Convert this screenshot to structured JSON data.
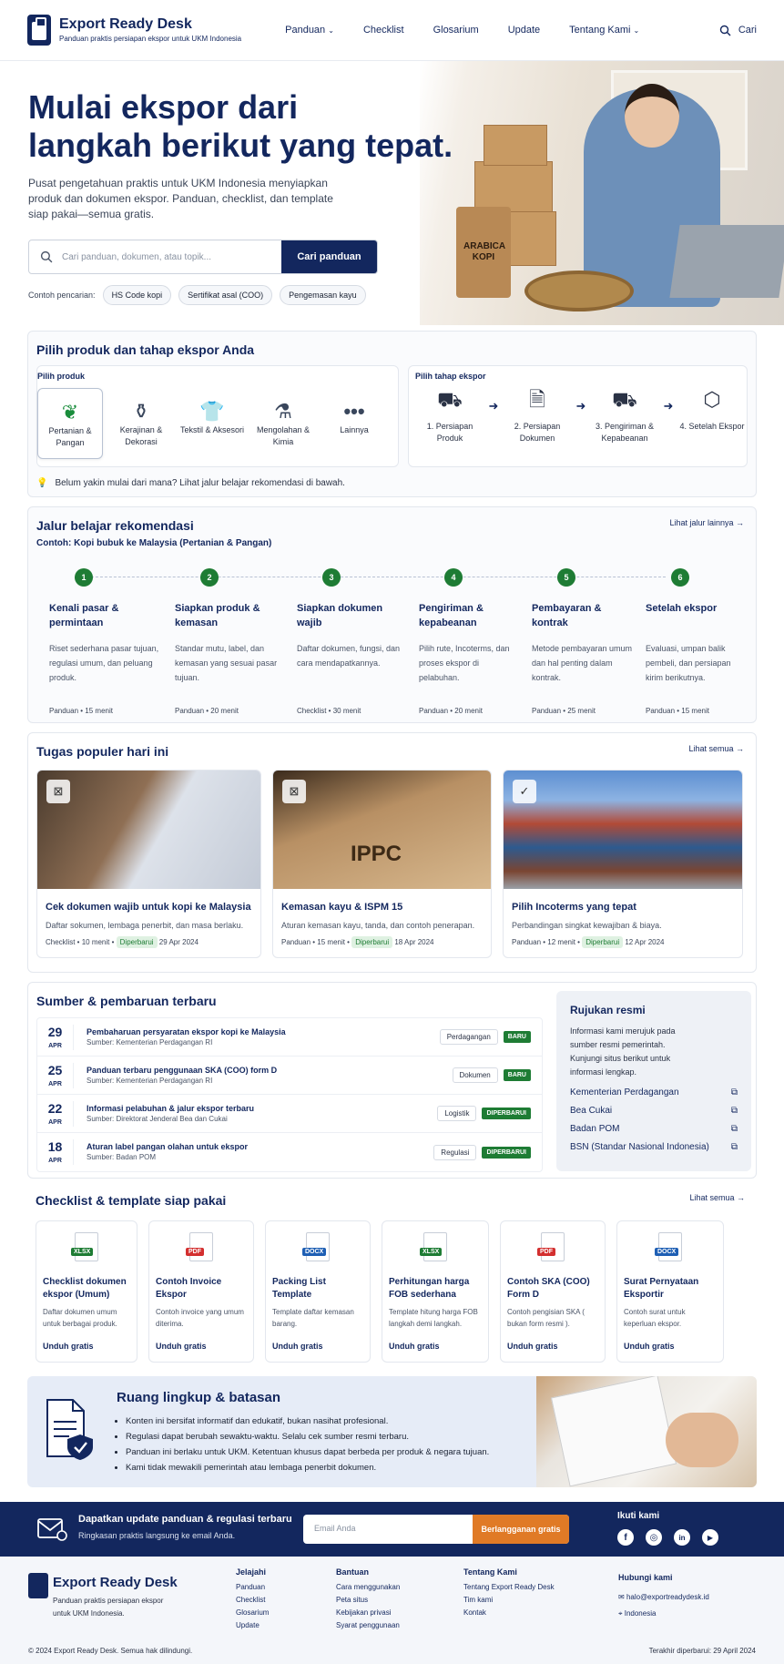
{
  "header": {
    "brand": "Export Ready Desk",
    "tagline": "Panduan praktis persiapan ekspor untuk UKM Indonesia",
    "nav": [
      "Panduan",
      "Checklist",
      "Glosarium",
      "Update",
      "Tentang Kami"
    ],
    "search_label": "Cari"
  },
  "hero": {
    "title_line1": "Mulai ekspor dari",
    "title_line2": "langkah berikut yang tepat.",
    "desc": "Pusat pengetahuan praktis untuk UKM Indonesia menyiapkan produk dan dokumen ekspor. Panduan, checklist, dan template siap pakai—semua gratis.",
    "search_placeholder": "Cari panduan, dokumen, atau topik...",
    "search_button": "Cari panduan",
    "examples_label": "Contoh pencarian:",
    "examples": [
      "HS Code kopi",
      "Sertifikat asal (COO)",
      "Pengemasan kayu"
    ],
    "bag_text": "ARABICA KOPI"
  },
  "picker": {
    "title": "Pilih produk dan tahap ekspor Anda",
    "product_label": "Pilih produk",
    "products": [
      "Pertanian & Pangan",
      "Kerajinan & Dekorasi",
      "Tekstil & Aksesori",
      "Mengolahan & Kimia",
      "Lainnya"
    ],
    "stage_label": "Pilih tahap ekspor",
    "stages": [
      "1. Persiapan Produk",
      "2. Persiapan Dokumen",
      "3. Pengiriman & Kepabeanan",
      "4. Setelah Ekspor"
    ],
    "hint": "Belum yakin mulai dari mana? Lihat jalur belajar rekomendasi di bawah."
  },
  "path": {
    "title": "Jalur belajar rekomendasi",
    "subtitle": "Contoh: Kopi bubuk ke Malaysia (Pertanian & Pangan)",
    "more": "Lihat jalur lainnya →",
    "steps": [
      {
        "n": "1",
        "title": "Kenali pasar & permintaan",
        "desc": "Riset sederhana pasar tujuan, regulasi umum, dan peluang produk.",
        "meta": "Panduan  •  15 menit"
      },
      {
        "n": "2",
        "title": "Siapkan produk & kemasan",
        "desc": "Standar mutu, label, dan kemasan yang sesuai pasar tujuan.",
        "meta": "Panduan  •  20 menit"
      },
      {
        "n": "3",
        "title": "Siapkan dokumen wajib",
        "desc": "Daftar dokumen, fungsi, dan cara mendapatkannya.",
        "meta": "Checklist  •  30 menit"
      },
      {
        "n": "4",
        "title": "Pengiriman & kepabeanan",
        "desc": "Pilih rute, Incoterms, dan proses ekspor di pelabuhan.",
        "meta": "Panduan  •  20 menit"
      },
      {
        "n": "5",
        "title": "Pembayaran & kontrak",
        "desc": "Metode pembayaran umum dan hal penting dalam kontrak.",
        "meta": "Panduan  •  25 menit"
      },
      {
        "n": "6",
        "title": "Setelah ekspor",
        "desc": "Evaluasi, umpan balik pembeli, dan persiapan kirim berikutnya.",
        "meta": "Panduan  •  15 menit"
      }
    ]
  },
  "tasks": {
    "title": "Tugas populer hari ini",
    "more": "Lihat semua →",
    "items": [
      {
        "title": "Cek dokumen wajib untuk kopi ke Malaysia",
        "desc": "Daftar sokumen, lembaga penerbit, dan masa berlaku.",
        "type": "Checklist  •  10 menit  •",
        "badge": "Diperbarui",
        "date": "29 Apr 2024"
      },
      {
        "title": "Kemasan kayu & ISPM 15",
        "desc": "Aturan kemasan kayu, tanda, dan contoh penerapan.",
        "type": "Panduan  •  15 menit  •",
        "badge": "Diperbarui",
        "date": "18 Apr 2024",
        "stamp": "IPPC"
      },
      {
        "title": "Pilih Incoterms yang tepat",
        "desc": "Perbandingan singkat kewajiban & biaya.",
        "type": "Panduan  •  12 menit  •",
        "badge": "Diperbarui",
        "date": "12 Apr 2024"
      }
    ]
  },
  "sources": {
    "title": "Sumber & pembaruan terbaru",
    "items": [
      {
        "day": "29",
        "mon": "APR",
        "title": "Pembaharuan persyaratan ekspor kopi ke Malaysia",
        "src": "Sumber: Kementerian Perdagangan RI",
        "cat": "Perdagangan",
        "badge": "BARU"
      },
      {
        "day": "25",
        "mon": "APR",
        "title": "Panduan terbaru penggunaan SKA (COO) form D",
        "src": "Sumber: Kementerian Perdagangan RI",
        "cat": "Dokumen",
        "badge": "BARU"
      },
      {
        "day": "22",
        "mon": "APR",
        "title": "Informasi pelabuhan & jalur ekspor terbaru",
        "src": "Sumber: Direktorat Jenderal Bea dan Cukai",
        "cat": "Logistik",
        "badge": "DIPERBARUI"
      },
      {
        "day": "18",
        "mon": "APR",
        "title": "Aturan label pangan olahan untuk ekspor",
        "src": "Sumber: Badan POM",
        "cat": "Regulasi",
        "badge": "DIPERBARUI"
      }
    ],
    "ref_title": "Rujukan resmi",
    "ref_desc": "Informasi kami merujuk pada sumber resmi pemerintah. Kunjungi situs berikut untuk informasi lengkap.",
    "refs": [
      "Kementerian Perdagangan",
      "Bea Cukai",
      "Badan POM",
      "BSN (Standar Nasional Indonesia)"
    ]
  },
  "templates": {
    "title": "Checklist & template siap pakai",
    "more": "Lihat semua →",
    "download": "Unduh gratis",
    "items": [
      {
        "fmt": "XLSX",
        "color": "#1e7c34",
        "title": "Checklist dokumen ekspor (Umum)",
        "desc": "Daftar dokumen umum untuk berbagai produk."
      },
      {
        "fmt": "PDF",
        "color": "#d32f2f",
        "title": "Contoh Invoice Ekspor",
        "desc": "Contoh invoice yang umum diterima."
      },
      {
        "fmt": "DOCX",
        "color": "#1e5fb4",
        "title": "Packing List Template",
        "desc": "Template daftar kemasan barang."
      },
      {
        "fmt": "XLSX",
        "color": "#1e7c34",
        "title": "Perhitungan harga FOB sederhana",
        "desc": "Template hitung harga FOB langkah demi langkah."
      },
      {
        "fmt": "PDF",
        "color": "#d32f2f",
        "title": "Contoh SKA (COO) Form D",
        "desc": "Contoh pengisian SKA ( bukan form resmi )."
      },
      {
        "fmt": "DOCX",
        "color": "#1e5fb4",
        "title": "Surat Pernyataan Eksportir",
        "desc": "Contoh surat untuk keperluan ekspor."
      }
    ]
  },
  "scope": {
    "title": "Ruang lingkup & batasan",
    "points": [
      "Konten ini bersifat informatif dan edukatif, bukan nasihat profesional.",
      "Regulasi dapat berubah sewaktu-waktu. Selalu cek sumber resmi terbaru.",
      "Panduan ini berlaku untuk UKM. Ketentuan khusus dapat berbeda per produk & negara tujuan.",
      "Kami tidak mewakili pemerintah atau lembaga penerbit dokumen."
    ]
  },
  "newsletter": {
    "title": "Dapatkan update panduan & regulasi terbaru",
    "sub": "Ringkasan praktis langsung ke email Anda.",
    "placeholder": "Email Anda",
    "button": "Berlangganan gratis",
    "follow": "Ikuti kami"
  },
  "footer": {
    "brand": "Export Ready Desk",
    "tagline": "Panduan praktis persiapan ekspor untuk UKM Indonesia.",
    "cols": [
      {
        "title": "Jelajahi",
        "links": [
          "Panduan",
          "Checklist",
          "Glosarium",
          "Update"
        ]
      },
      {
        "title": "Bantuan",
        "links": [
          "Cara menggunakan",
          "Peta situs",
          "Kebijakan privasi",
          "Syarat penggunaan"
        ]
      },
      {
        "title": "Tentang Kami",
        "links": [
          "Tentang Export Ready Desk",
          "Tim kami",
          "Kontak"
        ]
      }
    ],
    "contact_title": "Hubungi kami",
    "email": "halo@exportreadydesk.id",
    "location": "Indonesia",
    "copyright": "© 2024 Export Ready Desk. Semua hak dilindungi.",
    "updated": "Terakhir diperbarui: 29 April 2024"
  }
}
